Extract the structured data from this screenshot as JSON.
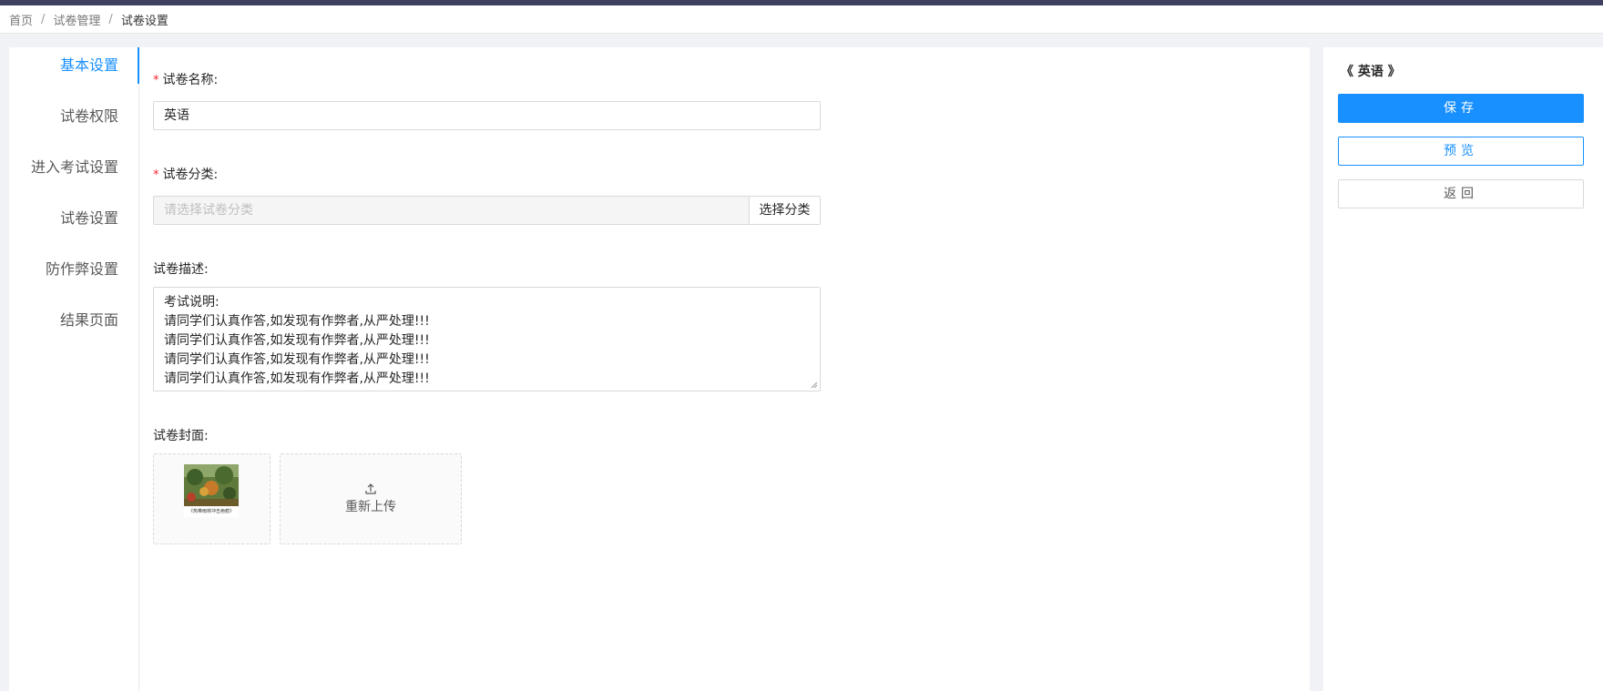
{
  "breadcrumb": {
    "items": [
      "首页",
      "试卷管理",
      "试卷设置"
    ],
    "separator": "/"
  },
  "side_nav": {
    "items": [
      {
        "label": "基本设置",
        "active": true
      },
      {
        "label": "试卷权限",
        "active": false
      },
      {
        "label": "进入考试设置",
        "active": false
      },
      {
        "label": "试卷设置",
        "active": false
      },
      {
        "label": "防作弊设置",
        "active": false
      },
      {
        "label": "结果页面",
        "active": false
      }
    ]
  },
  "form": {
    "name": {
      "required_mark": "*",
      "label": "试卷名称:",
      "value": "英语"
    },
    "category": {
      "required_mark": "*",
      "label": "试卷分类:",
      "placeholder": "请选择试卷分类",
      "button": "选择分类"
    },
    "description": {
      "label": "试卷描述:",
      "lines": [
        "考试说明:",
        "请同学们认真作答,如发现有作弊者,从严处理!!!",
        "请同学们认真作答,如发现有作弊者,从严处理!!!",
        "请同学们认真作答,如发现有作弊者,从严处理!!!",
        "请同学们认真作答,如发现有作弊者,从严处理!!!"
      ]
    },
    "cover": {
      "label": "试卷封面:",
      "thumbnail_caption": "《热带雨林冲击疤痕》",
      "reupload_label": "重新上传",
      "upload_icon": "upload-icon"
    }
  },
  "right_panel": {
    "title": "《 英语 》",
    "save_label": "保存",
    "preview_label": "预览",
    "back_label": "返回"
  },
  "colors": {
    "primary": "#1890ff",
    "topbar": "#3e4160",
    "required": "#f5222d",
    "background": "#f0f2f5"
  }
}
